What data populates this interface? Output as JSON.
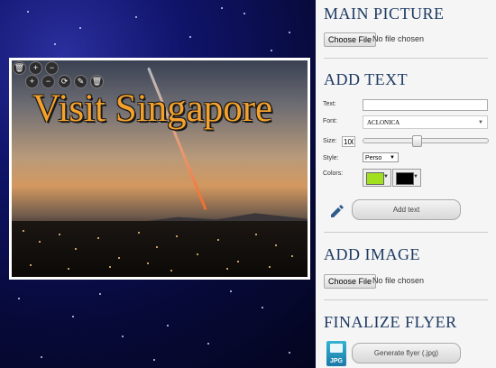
{
  "flyer": {
    "text": "Visit Singapore",
    "text_color": "#f6a22a",
    "tools": [
      "trash-icon",
      "zoom-in-icon",
      "zoom-out-icon",
      "zoom-in-icon",
      "zoom-out-icon",
      "rotate-icon",
      "edit-icon",
      "trash-icon"
    ]
  },
  "panel": {
    "main_picture": {
      "title": "MAIN PICTURE",
      "button": "Choose File",
      "status": "No file chosen"
    },
    "add_text": {
      "title": "ADD TEXT",
      "text_label": "Text:",
      "text_value": "",
      "font_label": "Font:",
      "font_value": "ACLONICA",
      "size_label": "Size:",
      "size_value": "100",
      "size_slider_fraction": 0.42,
      "style_label": "Style:",
      "style_value": "Perso",
      "colors_label": "Colors:",
      "fill_color": "#a0e01e",
      "stroke_color": "#000000",
      "button": "Add text"
    },
    "add_image": {
      "title": "ADD IMAGE",
      "button": "Choose File",
      "status": "No file chosen"
    },
    "finalize": {
      "title": "FINALIZE FLYER",
      "icon_label": "JPG",
      "button": "Generate flyer (.jpg)"
    }
  }
}
